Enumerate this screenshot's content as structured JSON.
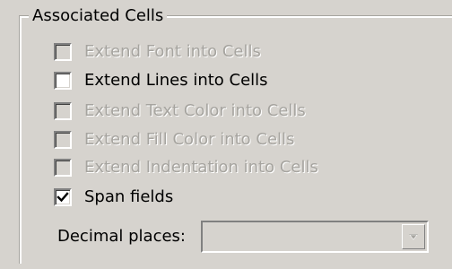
{
  "group": {
    "title": "Associated Cells"
  },
  "options": [
    {
      "label": "Extend Font into Cells",
      "checked": false,
      "enabled": false
    },
    {
      "label": "Extend Lines into Cells",
      "checked": false,
      "enabled": true
    },
    {
      "label": "Extend Text Color into Cells",
      "checked": false,
      "enabled": false
    },
    {
      "label": "Extend Fill Color into Cells",
      "checked": false,
      "enabled": false
    },
    {
      "label": "Extend Indentation into Cells",
      "checked": false,
      "enabled": false
    },
    {
      "label": "Span fields",
      "checked": true,
      "enabled": true
    }
  ],
  "decimal_places": {
    "label": "Decimal places:",
    "value": "",
    "enabled": false
  },
  "colors": {
    "background": "#d6d3ce",
    "disabled_text": "#a6a49f",
    "checkmark": "#000000"
  }
}
